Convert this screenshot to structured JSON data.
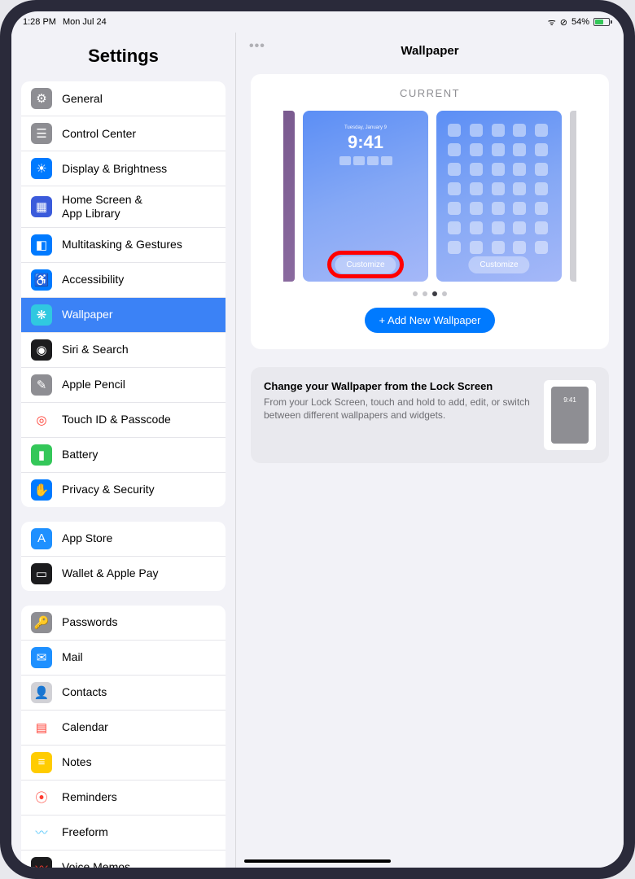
{
  "status": {
    "time": "1:28 PM",
    "date": "Mon Jul 24",
    "battery_pct": "54%"
  },
  "sidebar": {
    "title": "Settings",
    "groups": [
      [
        {
          "id": "general",
          "label": "General",
          "bg": "#8e8e93",
          "glyph": "⚙"
        },
        {
          "id": "control-center",
          "label": "Control Center",
          "bg": "#8e8e93",
          "glyph": "☰"
        },
        {
          "id": "display",
          "label": "Display & Brightness",
          "bg": "#007aff",
          "glyph": "☀"
        },
        {
          "id": "home-screen",
          "label": "Home Screen &\nApp Library",
          "bg": "#3b5bdb",
          "glyph": "▦"
        },
        {
          "id": "multitasking",
          "label": "Multitasking & Gestures",
          "bg": "#007aff",
          "glyph": "◧"
        },
        {
          "id": "accessibility",
          "label": "Accessibility",
          "bg": "#007aff",
          "glyph": "♿"
        },
        {
          "id": "wallpaper",
          "label": "Wallpaper",
          "bg": "#30c8e0",
          "glyph": "❋",
          "selected": true
        },
        {
          "id": "siri",
          "label": "Siri & Search",
          "bg": "#1c1c1e",
          "glyph": "◉"
        },
        {
          "id": "apple-pencil",
          "label": "Apple Pencil",
          "bg": "#8e8e93",
          "glyph": "✎"
        },
        {
          "id": "touch-id",
          "label": "Touch ID & Passcode",
          "bg": "#ffffff",
          "glyph": "◎",
          "fg": "#ff3b30"
        },
        {
          "id": "battery",
          "label": "Battery",
          "bg": "#34c759",
          "glyph": "▮"
        },
        {
          "id": "privacy",
          "label": "Privacy & Security",
          "bg": "#007aff",
          "glyph": "✋"
        }
      ],
      [
        {
          "id": "app-store",
          "label": "App Store",
          "bg": "#1e90ff",
          "glyph": "A"
        },
        {
          "id": "wallet",
          "label": "Wallet & Apple Pay",
          "bg": "#1c1c1e",
          "glyph": "▭"
        }
      ],
      [
        {
          "id": "passwords",
          "label": "Passwords",
          "bg": "#8e8e93",
          "glyph": "🔑"
        },
        {
          "id": "mail",
          "label": "Mail",
          "bg": "#1e90ff",
          "glyph": "✉"
        },
        {
          "id": "contacts",
          "label": "Contacts",
          "bg": "#d1d1d6",
          "glyph": "👤",
          "fg": "#8e8e93"
        },
        {
          "id": "calendar",
          "label": "Calendar",
          "bg": "#ffffff",
          "glyph": "▤",
          "fg": "#ff3b30"
        },
        {
          "id": "notes",
          "label": "Notes",
          "bg": "#ffcc00",
          "glyph": "≡",
          "fg": "#fff"
        },
        {
          "id": "reminders",
          "label": "Reminders",
          "bg": "#ffffff",
          "glyph": "⦿",
          "fg": "#ff3b30"
        },
        {
          "id": "freeform",
          "label": "Freeform",
          "bg": "#ffffff",
          "glyph": "〰",
          "fg": "#5ac8fa"
        },
        {
          "id": "voice-memos",
          "label": "Voice Memos",
          "bg": "#1c1c1e",
          "glyph": "〰",
          "fg": "#ff3b30"
        }
      ]
    ]
  },
  "main": {
    "title": "Wallpaper",
    "current_label": "CURRENT",
    "lock_preview": {
      "date": "Tuesday, January 9",
      "time": "9:41",
      "customize": "Customize"
    },
    "home_preview": {
      "customize": "Customize"
    },
    "add_button": "+ Add New Wallpaper",
    "page_dots": {
      "count": 4,
      "active": 2
    },
    "info": {
      "title": "Change your Wallpaper from the Lock Screen",
      "desc": "From your Lock Screen, touch and hold to add, edit, or switch between different wallpapers and widgets.",
      "thumb_time": "9:41"
    }
  }
}
